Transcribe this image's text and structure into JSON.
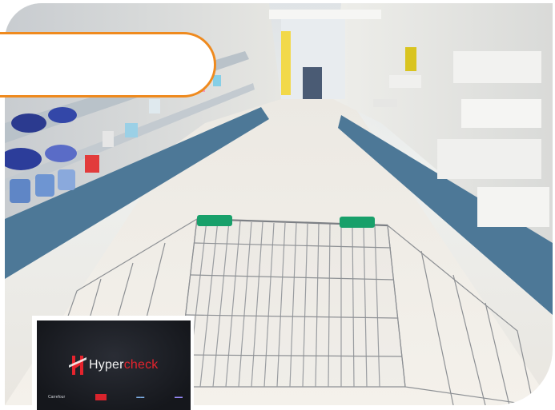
{
  "scene": {
    "description_colors": {
      "accent_orange": "#ef8a1e",
      "shelf_blue": "#3f6d8c",
      "cart_green": "#18a06a",
      "brand_red": "#e5232d"
    }
  },
  "logo": {
    "word_part1": "Hyper",
    "word_part2": "check",
    "partners": [
      "Carrefour",
      "",
      "",
      ""
    ]
  },
  "icons": {
    "brand_mark": "hypercheck-logo-icon",
    "cart": "shopping-cart"
  }
}
